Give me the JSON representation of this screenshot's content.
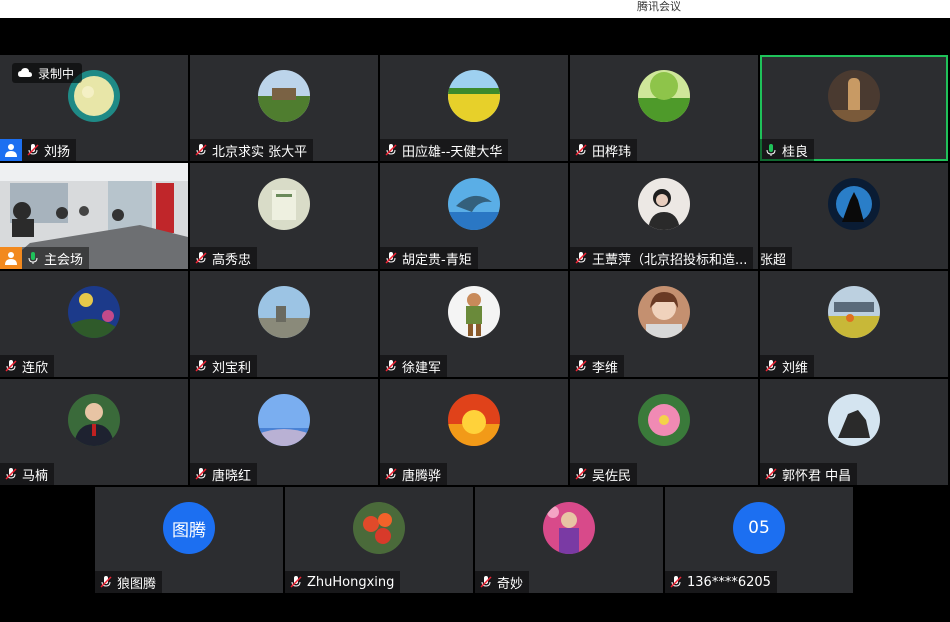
{
  "window": {
    "title": "腾讯会议"
  },
  "recording": {
    "label": "录制中"
  },
  "participants_row1": [
    {
      "name": "刘扬",
      "badge": "host"
    },
    {
      "name": "北京求实   张大平"
    },
    {
      "name": "田应雄--天健大华"
    },
    {
      "name": "田桦玮"
    },
    {
      "name": "桂良",
      "speaking": true
    }
  ],
  "participants_row2": [
    {
      "name": "主会场",
      "badge": "room"
    },
    {
      "name": "高秀忠"
    },
    {
      "name": "胡定贵-青矩"
    },
    {
      "name": "王蕈萍（北京招投标和造..."
    },
    {
      "name": "张超"
    }
  ],
  "participants_row3": [
    {
      "name": "连欣"
    },
    {
      "name": "刘宝利"
    },
    {
      "name": "徐建军"
    },
    {
      "name": "李维"
    },
    {
      "name": "刘维"
    }
  ],
  "participants_row4": [
    {
      "name": "马楠"
    },
    {
      "name": "唐晓红"
    },
    {
      "name": "唐腾骅"
    },
    {
      "name": "吴佐民"
    },
    {
      "name": "郭怀君 中昌"
    }
  ],
  "participants_row5": [
    {
      "name": "狼图腾",
      "avatar_text": "图腾"
    },
    {
      "name": "ZhuHongxing"
    },
    {
      "name": "奇妙"
    },
    {
      "name": "136****6205",
      "avatar_text": "05"
    }
  ],
  "colors": {
    "tile_bg": "#2c2d30",
    "accent": "#1c6ff1",
    "speaking": "#1fc25a",
    "host_badge": "#1c6ff1",
    "room_badge": "#f2891e"
  }
}
